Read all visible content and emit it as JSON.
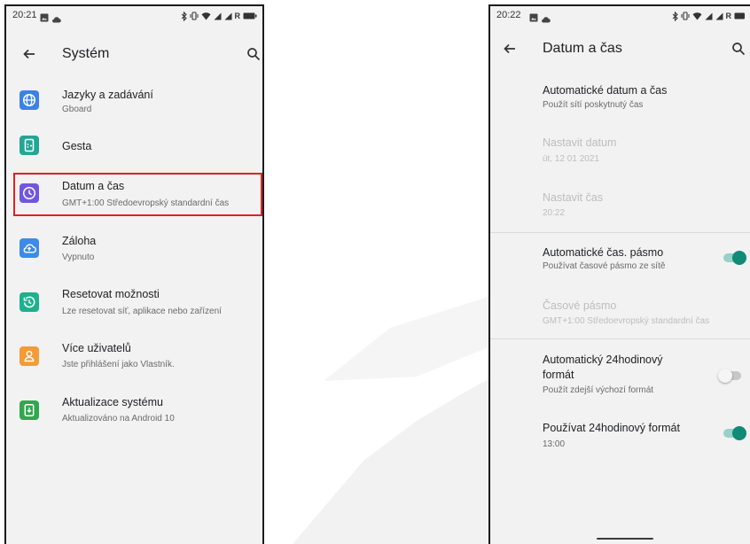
{
  "left_phone": {
    "status": {
      "time": "20:21",
      "roaming": "R"
    },
    "toolbar": {
      "title": "Systém"
    },
    "items": [
      {
        "title": "Jazyky a zadávání",
        "subtitle": "Gboard",
        "icon": "globe-icon",
        "color": "#3c82e6"
      },
      {
        "title": "Gesta",
        "icon": "gesture-icon",
        "color": "#22a696"
      },
      {
        "title": "Datum a čas",
        "subtitle": "GMT+1:00 Středoevropský standardní čas",
        "icon": "clock-icon",
        "color": "#7157df"
      },
      {
        "title": "Záloha",
        "subtitle": "Vypnuto",
        "icon": "cloud-backup-icon",
        "color": "#3d8ae8"
      },
      {
        "title": "Resetovat možnosti",
        "subtitle": "Lze resetovat síť, aplikace nebo zařízení",
        "icon": "restore-icon",
        "color": "#1fb08d"
      },
      {
        "title": "Více uživatelů",
        "subtitle": "Jste přihlášení jako Vlastník.",
        "icon": "user-icon",
        "color": "#f29b37"
      },
      {
        "title": "Aktualizace systému",
        "subtitle": "Aktualizováno na Android 10",
        "icon": "system-update-icon",
        "color": "#2fa84f"
      }
    ],
    "highlight_color": "#e02020"
  },
  "right_phone": {
    "status": {
      "time": "20:22",
      "roaming": "R"
    },
    "toolbar": {
      "title": "Datum a čas"
    },
    "settings": [
      {
        "title": "Automatické datum a čas",
        "subtitle": "Použít sítí poskytnutý čas",
        "enabled": true
      },
      {
        "title": "Nastavit datum",
        "subtitle": "út, 12 01 2021",
        "enabled": false
      },
      {
        "title": "Nastavit čas",
        "subtitle": "20:22",
        "enabled": false
      },
      {
        "title": "Automatické čas. pásmo",
        "subtitle": "Používat časové pásmo ze sítě",
        "enabled": true,
        "toggle": true
      },
      {
        "title": "Časové pásmo",
        "subtitle": "GMT+1:00 Středoevropský standardní čas",
        "enabled": false
      },
      {
        "title": "Automatický 24hodinový formát",
        "subtitle": "Použít zdejší výchozí formát",
        "enabled": true,
        "toggle": false
      },
      {
        "title": "Používat 24hodinový formát",
        "subtitle": "13:00",
        "enabled": true,
        "toggle": true
      }
    ]
  },
  "colors": {
    "accent": "#0f8b76",
    "background": "#f2f2f2"
  }
}
